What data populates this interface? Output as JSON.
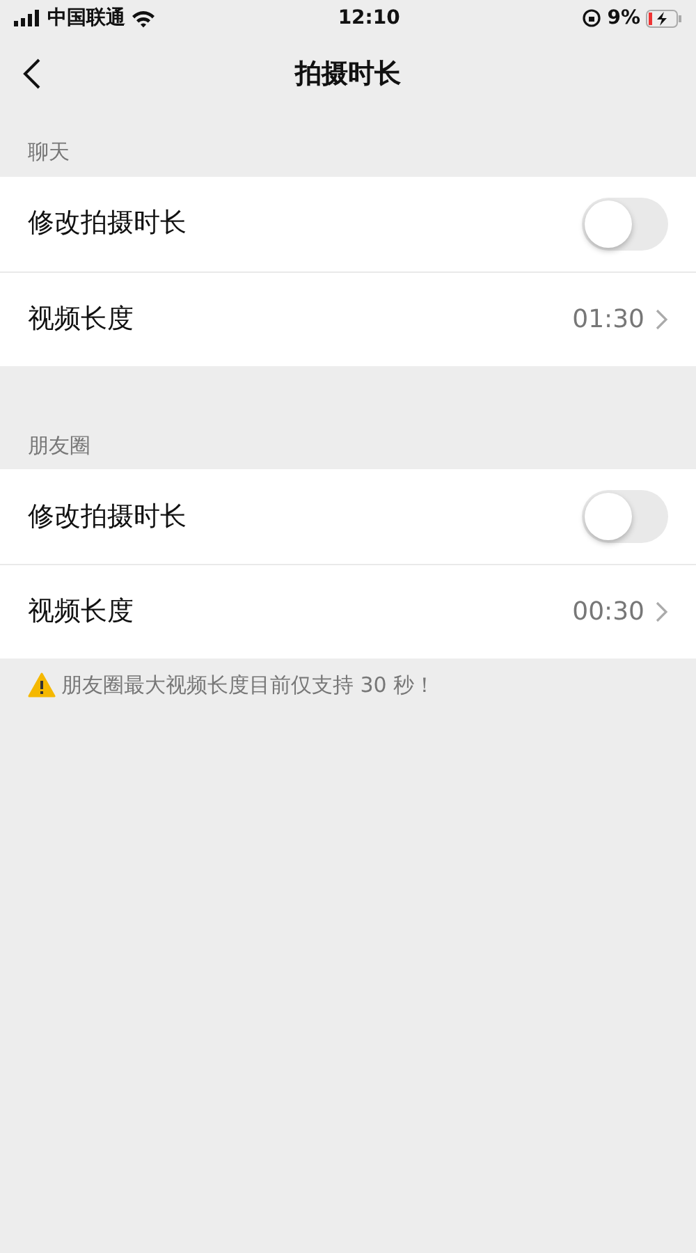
{
  "status_bar": {
    "carrier": "中国联通",
    "time": "12:10",
    "battery": "9%"
  },
  "nav": {
    "title": "拍摄时长"
  },
  "sections": [
    {
      "header": "聊天",
      "rows": [
        {
          "kind": "toggle",
          "label": "修改拍摄时长",
          "on": false
        },
        {
          "kind": "value",
          "label": "视频长度",
          "value": "01:30"
        }
      ]
    },
    {
      "header": "朋友圈",
      "rows": [
        {
          "kind": "toggle",
          "label": "修改拍摄时长",
          "on": false
        },
        {
          "kind": "value",
          "label": "视频长度",
          "value": "00:30"
        }
      ]
    }
  ],
  "note": "朋友圈最大视频长度目前仅支持 30 秒！"
}
